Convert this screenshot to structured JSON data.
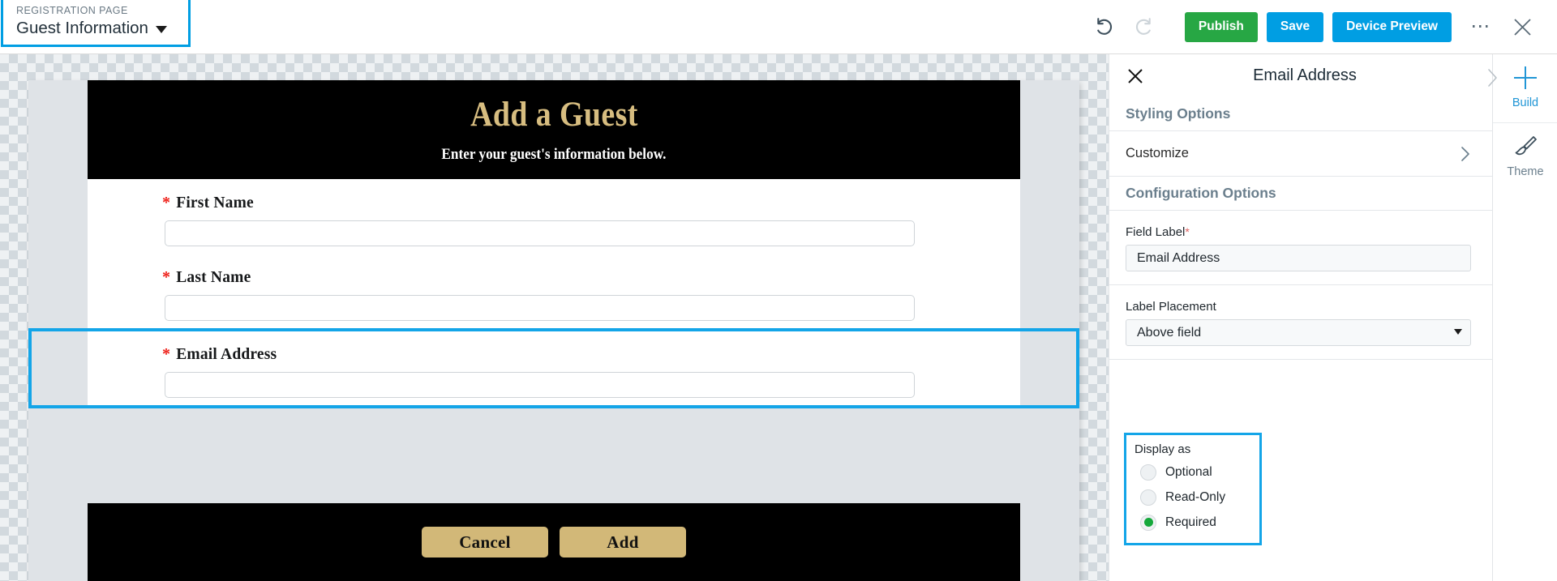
{
  "header": {
    "page_selector": {
      "kicker": "REGISTRATION PAGE",
      "title": "Guest Information",
      "caret_icon": "chevron-down-icon"
    },
    "undo_icon": "undo-icon",
    "redo_icon": "redo-icon",
    "publish_label": "Publish",
    "save_label": "Save",
    "device_preview_label": "Device Preview",
    "more_label": "•••",
    "more_icon": "ellipsis-icon",
    "close_icon": "close-icon",
    "accent_green": "#27a744",
    "accent_blue": "#009ee3"
  },
  "canvas": {
    "banner": {
      "title": "Add a Guest",
      "subtitle": "Enter your guest's information below.",
      "background": "#000000",
      "title_color": "#d7bd80",
      "subtitle_color": "#ffffff"
    },
    "fields": [
      {
        "label": "First Name",
        "required_marker": "*",
        "value": "",
        "placeholder": ""
      },
      {
        "label": "Last Name",
        "required_marker": "*",
        "value": "",
        "placeholder": ""
      },
      {
        "label": "Email Address",
        "required_marker": "*",
        "value": "",
        "placeholder": "",
        "selected": true
      }
    ],
    "footer": {
      "cancel_label": "Cancel",
      "add_label": "Add",
      "button_color": "#d2b878",
      "background": "#000000"
    },
    "selection_color": "#13a5e8"
  },
  "properties_panel": {
    "close_icon": "close-icon",
    "title": "Email Address",
    "styling_options_header": "Styling Options",
    "customize_row": {
      "label": "Customize",
      "chevron_icon": "chevron-right-icon"
    },
    "configuration_options_header": "Configuration Options",
    "field_label": {
      "label": "Field Label",
      "required_marker": "*",
      "value": "Email Address"
    },
    "label_placement": {
      "label": "Label Placement",
      "value": "Above field",
      "caret_icon": "chevron-down-icon",
      "options": [
        "Above field"
      ]
    },
    "display_as": {
      "label": "Display as",
      "selected": "Required",
      "options": [
        {
          "label": "Optional",
          "checked": false
        },
        {
          "label": "Read-Only",
          "checked": false
        },
        {
          "label": "Required",
          "checked": true
        }
      ],
      "checked_color": "#15a83b",
      "highlight_color": "#13a5e8"
    }
  },
  "rail": {
    "collapse_icon": "chevron-right-icon",
    "items": [
      {
        "label": "Build",
        "icon": "plus-icon",
        "active": true
      },
      {
        "label": "Theme",
        "icon": "paintbrush-icon",
        "active": false
      }
    ]
  }
}
